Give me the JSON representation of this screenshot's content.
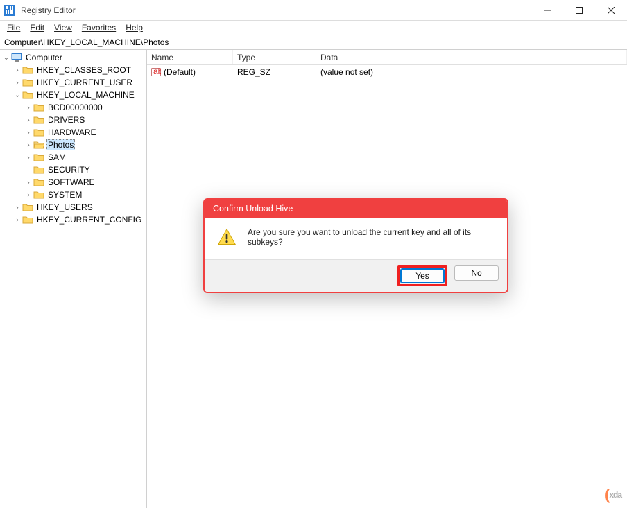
{
  "window": {
    "title": "Registry Editor"
  },
  "menu": {
    "file": "File",
    "edit": "Edit",
    "view": "View",
    "favorites": "Favorites",
    "help": "Help"
  },
  "address": "Computer\\HKEY_LOCAL_MACHINE\\Photos",
  "tree": {
    "root": "Computer",
    "hkcr": "HKEY_CLASSES_ROOT",
    "hkcu": "HKEY_CURRENT_USER",
    "hklm": "HKEY_LOCAL_MACHINE",
    "hklm_children": {
      "bcd": "BCD00000000",
      "drivers": "DRIVERS",
      "hardware": "HARDWARE",
      "photos": "Photos",
      "sam": "SAM",
      "security": "SECURITY",
      "software": "SOFTWARE",
      "system": "SYSTEM"
    },
    "hku": "HKEY_USERS",
    "hkcc": "HKEY_CURRENT_CONFIG"
  },
  "columns": {
    "name": "Name",
    "type": "Type",
    "data": "Data"
  },
  "values": [
    {
      "name": "(Default)",
      "type": "REG_SZ",
      "data": "(value not set)"
    }
  ],
  "dialog": {
    "title": "Confirm Unload Hive",
    "message": "Are you sure you want to unload the current key and all of its subkeys?",
    "yes": "Yes",
    "no": "No"
  },
  "watermark": {
    "prefix": "(",
    "text": "xda"
  }
}
